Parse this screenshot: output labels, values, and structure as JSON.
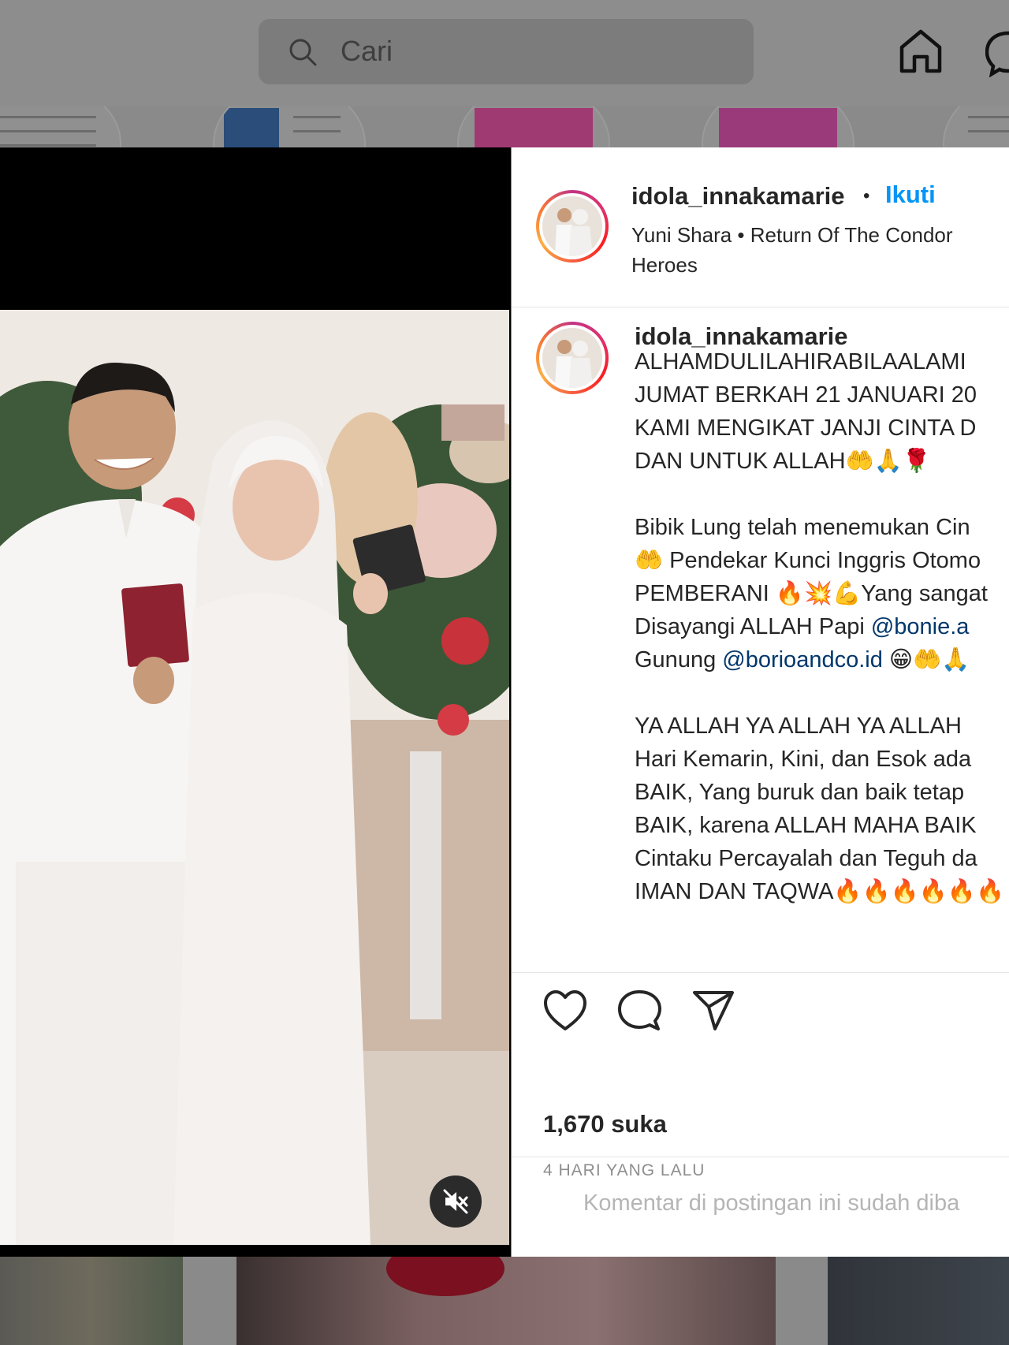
{
  "header": {
    "search_placeholder": "Cari",
    "icons": [
      "search-icon",
      "home-icon",
      "messenger-icon"
    ]
  },
  "post": {
    "username": "idola_innakamarie",
    "separator": "•",
    "follow_label": "Ikuti",
    "audio": "Yuni Shara • Return Of The Condor Heroes",
    "caption_username": "idola_innakamarie",
    "caption": {
      "p1": "ALHAMDULILAHIRABILAALAMI\nJUMAT BERKAH 21 JANUARI 20\nKAMI MENGIKAT JANJI CINTA D\nDAN UNTUK ALLAH🤲🙏🌹",
      "p2_a": "Bibik Lung telah menemukan Cin\n🤲 Pendekar Kunci Inggris Otomo\nPEMBERANI 🔥💥💪Yang sangat\nDisayangi ALLAH Papi ",
      "mention1": "@bonie.a",
      "p2_b": "\nGunung ",
      "mention2": "@borioandco.id",
      "p2_c": " 😁🤲🙏",
      "p3": "YA ALLAH YA ALLAH YA ALLAH\nHari Kemarin, Kini, dan Esok ada\nBAIK, Yang buruk dan baik tetap\nBAIK, karena ALLAH MAHA BAIK\nCintaku Percayalah dan Teguh da\nIMAN DAN TAQWA🔥🔥🔥🔥🔥🔥"
    },
    "likes": "1,670 suka",
    "timestamp": "4 HARI YANG LALU",
    "comments_disabled": "Komentar di postingan ini sudah diba"
  },
  "colors": {
    "accent": "#0095f6",
    "mention": "#00376b",
    "text": "#262626",
    "muted": "#8e8e8e",
    "overlay": "#8a8a8a"
  }
}
